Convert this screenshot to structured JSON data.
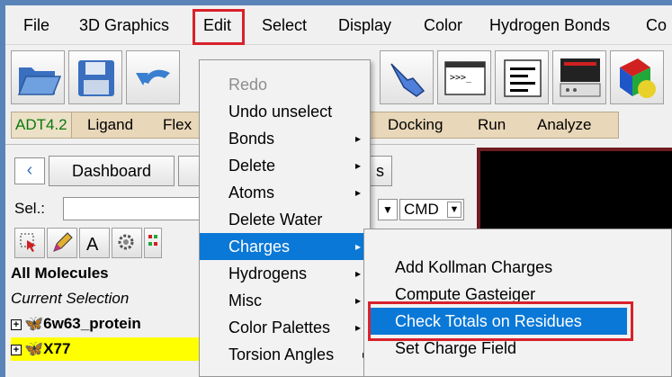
{
  "menubar": {
    "items": [
      "File",
      "3D Graphics",
      "Edit",
      "Select",
      "Display",
      "Color",
      "Hydrogen Bonds",
      "Co"
    ]
  },
  "adt_tabs": [
    "ADT4.2",
    "Ligand",
    "Flex",
    "Docking",
    "Run",
    "Analyze"
  ],
  "dashboard": {
    "label": "Dashboard",
    "second_tab_suffix": "s"
  },
  "selection": {
    "label": "Sel.:",
    "value": "",
    "cmd_label": "CMD"
  },
  "tree": {
    "all_molecules": "All Molecules",
    "current_selection": "Current Selection",
    "items": [
      "6w63_protein",
      "X77"
    ],
    "expander": "+"
  },
  "edit_menu": {
    "items": [
      {
        "label": "Redo",
        "state": "disabled",
        "has_submenu": false
      },
      {
        "label": "Undo unselect",
        "state": "normal",
        "has_submenu": false
      },
      {
        "label": "Bonds",
        "state": "normal",
        "has_submenu": true
      },
      {
        "label": "Delete",
        "state": "normal",
        "has_submenu": true
      },
      {
        "label": "Atoms",
        "state": "normal",
        "has_submenu": true
      },
      {
        "label": "Delete Water",
        "state": "normal",
        "has_submenu": false
      },
      {
        "label": "Charges",
        "state": "active",
        "has_submenu": true
      },
      {
        "label": "Hydrogens",
        "state": "normal",
        "has_submenu": true
      },
      {
        "label": "Misc",
        "state": "normal",
        "has_submenu": true
      },
      {
        "label": "Color Palettes",
        "state": "normal",
        "has_submenu": true
      },
      {
        "label": "Torsion Angles",
        "state": "normal",
        "has_submenu": true
      }
    ]
  },
  "charges_submenu": {
    "items": [
      {
        "label": "Add Kollman Charges",
        "state": "normal"
      },
      {
        "label": "Compute Gasteiger",
        "state": "normal"
      },
      {
        "label": "Check Totals on Residues",
        "state": "active"
      },
      {
        "label": "Set Charge Field",
        "state": "normal"
      }
    ]
  },
  "colors": {
    "highlight": "#0a78d7",
    "annotation_red": "#d9212b",
    "adt_tab_bg": "#e8d7b8",
    "selected_row": "#ffff00"
  },
  "icons": {
    "submenu_arrow": "▸",
    "dropdown_arrow": "▼",
    "back_arrow": "‹"
  }
}
